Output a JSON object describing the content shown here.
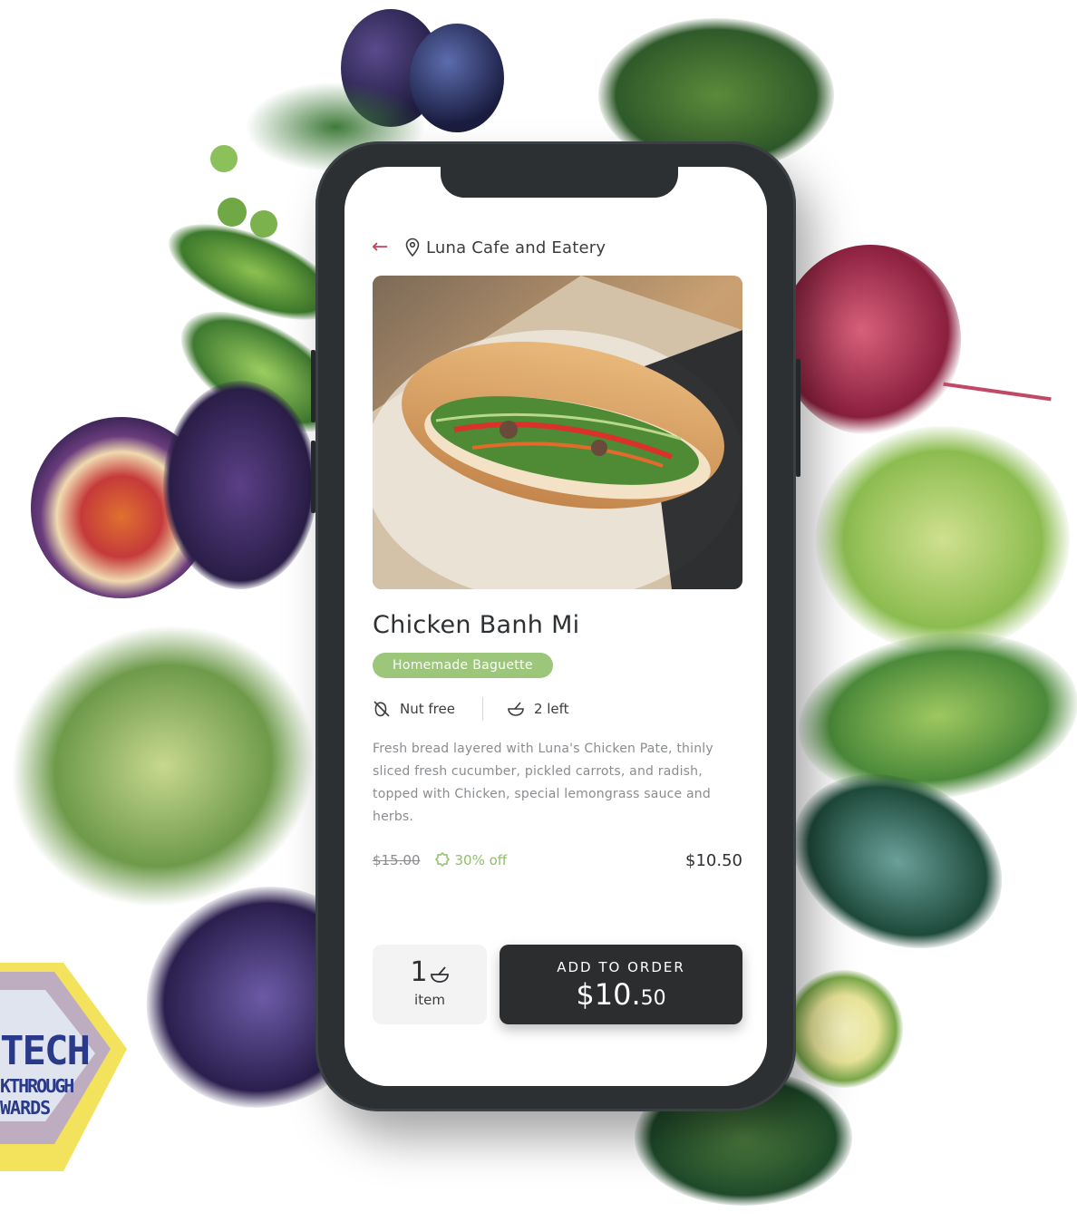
{
  "header": {
    "venue_name": "Luna Cafe and Eatery",
    "back_icon": "back-arrow-icon",
    "location_icon": "map-pin-icon"
  },
  "item": {
    "name": "Chicken Banh Mi",
    "tag": "Homemade Baguette",
    "attributes": [
      {
        "icon": "nut-free-icon",
        "label": "Nut free"
      },
      {
        "icon": "bowl-icon",
        "label": "2 left"
      }
    ],
    "description": "Fresh bread layered with Luna's Chicken Pate, thinly sliced fresh cucumber, pickled carrots, and radish, topped with Chicken, special lemongrass sauce and herbs.",
    "original_price": "$15.00",
    "discount": "30% off",
    "price": "$10.50"
  },
  "order": {
    "quantity": "1",
    "quantity_unit": "item",
    "add_label": "ADD TO ORDER",
    "add_price_main": "$10.",
    "add_price_cents": "50"
  },
  "badge": {
    "line1": "TECH",
    "line2": "KTHROUGH",
    "line3": "WARDS"
  },
  "colors": {
    "accent_green": "#9cc67a",
    "back_arrow": "#c0475b",
    "button_dark": "#2b2d2f",
    "phone_frame": "#2c3033"
  }
}
